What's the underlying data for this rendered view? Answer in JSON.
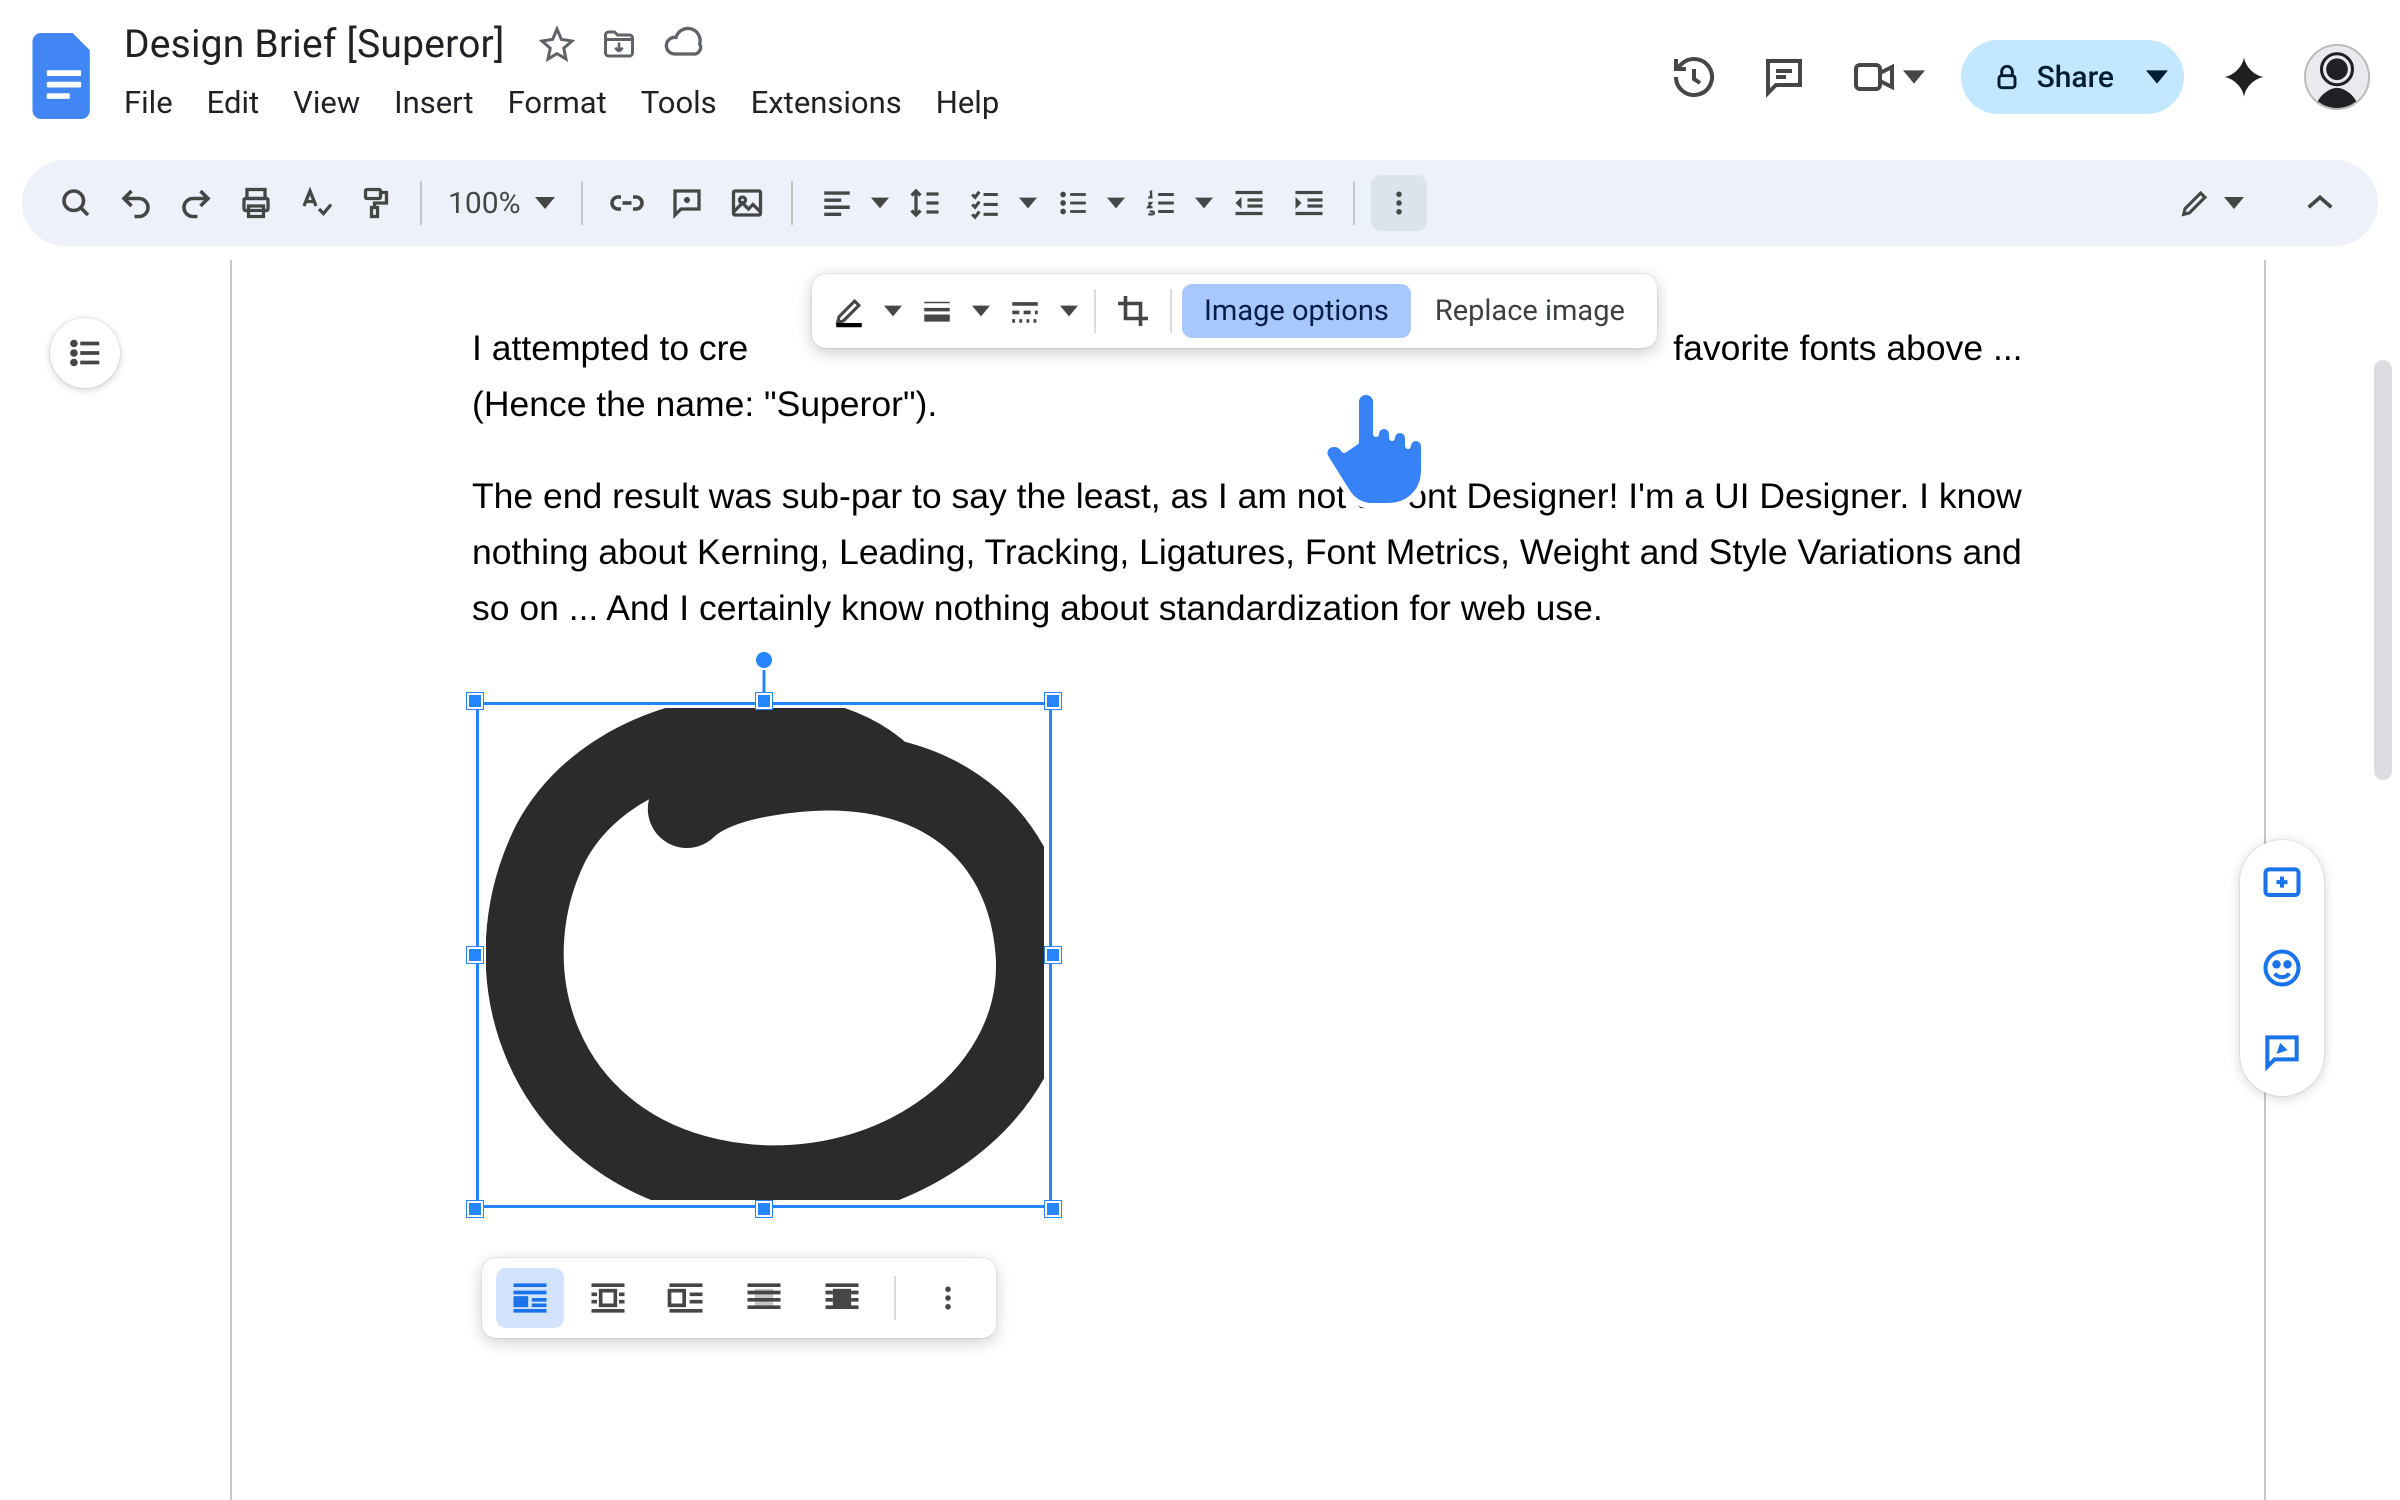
{
  "header": {
    "doc_title": "Design Brief [Superor]",
    "menus": [
      "File",
      "Edit",
      "View",
      "Insert",
      "Format",
      "Tools",
      "Extensions",
      "Help"
    ],
    "share_label": "Share"
  },
  "toolbar": {
    "zoom": "100%"
  },
  "image_toolbar": {
    "image_options": "Image options",
    "replace_image": "Replace image"
  },
  "document": {
    "para1_a": "I attempted to cre",
    "para1_b": " favorite fonts above ...  (Hence the name: \"Superor\").",
    "para2": "The end result was sub-par to say the least, as I am not a Font Designer! I'm a UI Designer. I know nothing about Kerning, Leading, Tracking, Ligatures, Font Metrics, Weight and Style Variations and so on ... And I certainly know nothing about standardization for web use."
  },
  "colors": {
    "accent": "#2684fc",
    "share_bg": "#c2e7ff",
    "toolbar_bg": "#edf2fa"
  }
}
